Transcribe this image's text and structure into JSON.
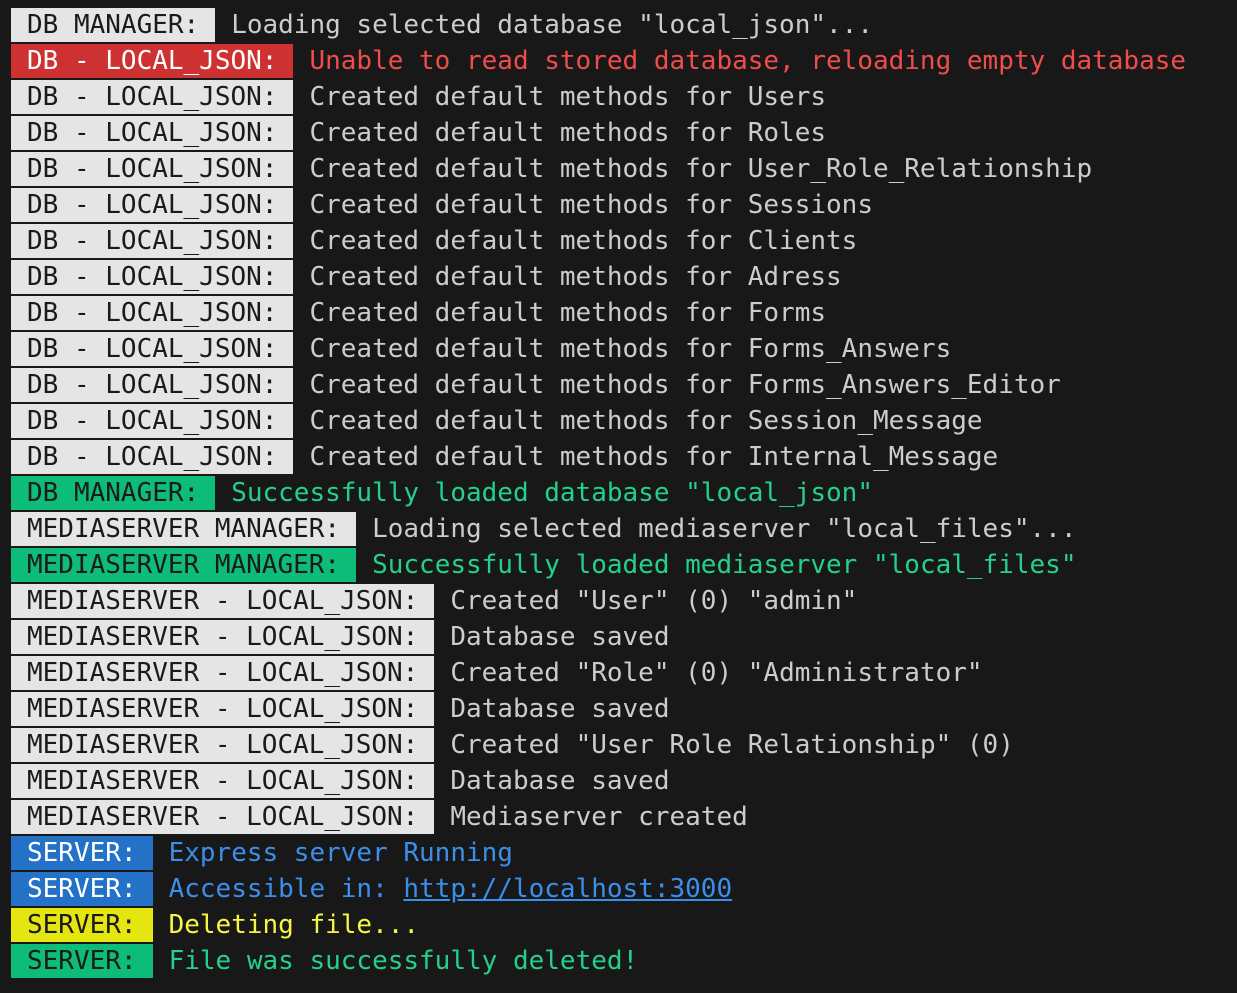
{
  "colors": {
    "background": "#181818",
    "tag_default_bg": "#e5e5e5",
    "tag_default_fg": "#1a1a1a",
    "message_default": "#cccccc",
    "error": "#f14c4c",
    "error_tag_bg": "#cd3131",
    "success": "#23d18b",
    "success_tag_bg": "#0dbc79",
    "info": "#3b8eea",
    "info_tag_bg": "#2472c8",
    "warning": "#f5f543",
    "warning_tag_bg": "#e5e510"
  },
  "lines": [
    {
      "tag": "DB MANAGER:",
      "text": "Loading selected database \"local_json\"...",
      "style": "default"
    },
    {
      "tag": "DB - LOCAL_JSON:",
      "text": "Unable to read stored database, reloading empty database",
      "style": "error"
    },
    {
      "tag": "DB - LOCAL_JSON:",
      "text": "Created default methods for Users",
      "style": "default"
    },
    {
      "tag": "DB - LOCAL_JSON:",
      "text": "Created default methods for Roles",
      "style": "default"
    },
    {
      "tag": "DB - LOCAL_JSON:",
      "text": "Created default methods for User_Role_Relationship",
      "style": "default"
    },
    {
      "tag": "DB - LOCAL_JSON:",
      "text": "Created default methods for Sessions",
      "style": "default"
    },
    {
      "tag": "DB - LOCAL_JSON:",
      "text": "Created default methods for Clients",
      "style": "default"
    },
    {
      "tag": "DB - LOCAL_JSON:",
      "text": "Created default methods for Adress",
      "style": "default"
    },
    {
      "tag": "DB - LOCAL_JSON:",
      "text": "Created default methods for Forms",
      "style": "default"
    },
    {
      "tag": "DB - LOCAL_JSON:",
      "text": "Created default methods for Forms_Answers",
      "style": "default"
    },
    {
      "tag": "DB - LOCAL_JSON:",
      "text": "Created default methods for Forms_Answers_Editor",
      "style": "default"
    },
    {
      "tag": "DB - LOCAL_JSON:",
      "text": "Created default methods for Session_Message",
      "style": "default"
    },
    {
      "tag": "DB - LOCAL_JSON:",
      "text": "Created default methods for Internal_Message",
      "style": "default"
    },
    {
      "tag": "DB MANAGER:",
      "text": "Successfully loaded database \"local_json\"",
      "style": "success"
    },
    {
      "tag": "MEDIASERVER MANAGER:",
      "text": "Loading selected mediaserver \"local_files\"...",
      "style": "default"
    },
    {
      "tag": "MEDIASERVER MANAGER:",
      "text": "Successfully loaded mediaserver \"local_files\"",
      "style": "success"
    },
    {
      "tag": "MEDIASERVER - LOCAL_JSON:",
      "text": "Created \"User\" (0) \"admin\"",
      "style": "default"
    },
    {
      "tag": "MEDIASERVER - LOCAL_JSON:",
      "text": "Database saved",
      "style": "default"
    },
    {
      "tag": "MEDIASERVER - LOCAL_JSON:",
      "text": "Created \"Role\" (0) \"Administrator\"",
      "style": "default"
    },
    {
      "tag": "MEDIASERVER - LOCAL_JSON:",
      "text": "Database saved",
      "style": "default"
    },
    {
      "tag": "MEDIASERVER - LOCAL_JSON:",
      "text": "Created \"User Role Relationship\" (0)",
      "style": "default"
    },
    {
      "tag": "MEDIASERVER - LOCAL_JSON:",
      "text": "Database saved",
      "style": "default"
    },
    {
      "tag": "MEDIASERVER - LOCAL_JSON:",
      "text": "Mediaserver created",
      "style": "default"
    },
    {
      "tag": "SERVER:",
      "text": "Express server Running",
      "style": "info"
    },
    {
      "tag": "SERVER:",
      "text": "Accessible in: ",
      "link": "http://localhost:3000",
      "style": "info"
    },
    {
      "tag": "SERVER:",
      "text": "Deleting file...",
      "style": "warning"
    },
    {
      "tag": "SERVER:",
      "text": "File was successfully deleted!",
      "style": "success"
    }
  ]
}
